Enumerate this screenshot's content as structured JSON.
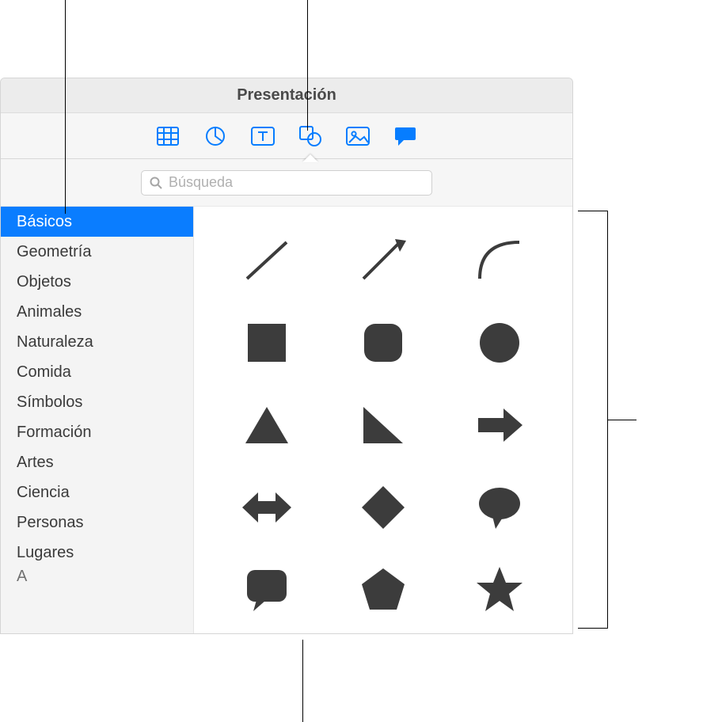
{
  "window": {
    "title": "Presentación"
  },
  "search": {
    "placeholder": "Búsqueda",
    "value": ""
  },
  "toolbar": [
    {
      "name": "table-icon"
    },
    {
      "name": "chart-icon"
    },
    {
      "name": "text-icon"
    },
    {
      "name": "shape-icon",
      "active": true
    },
    {
      "name": "media-icon"
    },
    {
      "name": "comment-icon"
    }
  ],
  "categories": [
    {
      "label": "Básicos",
      "selected": true
    },
    {
      "label": "Geometría"
    },
    {
      "label": "Objetos"
    },
    {
      "label": "Animales"
    },
    {
      "label": "Naturaleza"
    },
    {
      "label": "Comida"
    },
    {
      "label": "Símbolos"
    },
    {
      "label": "Formación"
    },
    {
      "label": "Artes"
    },
    {
      "label": "Ciencia"
    },
    {
      "label": "Personas"
    },
    {
      "label": "Lugares"
    },
    {
      "label": "Actividades",
      "clipped": true
    }
  ],
  "shapes": [
    "line",
    "arrow-line",
    "curve",
    "square",
    "rounded-square",
    "circle",
    "triangle",
    "right-triangle",
    "arrow-right",
    "double-arrow-horizontal",
    "diamond",
    "speech-bubble-oval",
    "speech-bubble-square",
    "pentagon",
    "star"
  ],
  "shape_color": "#3c3c3c"
}
